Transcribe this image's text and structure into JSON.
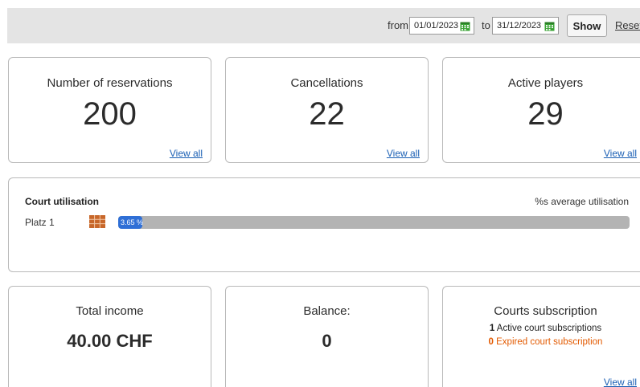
{
  "filter": {
    "from_label": "from",
    "from_value": "01/01/2023",
    "to_label": "to",
    "to_value": "31/12/2023",
    "show_label": "Show",
    "reset_label": "Reset"
  },
  "stats": {
    "reservations": {
      "title": "Number of reservations",
      "value": "200",
      "link": "View all"
    },
    "cancellations": {
      "title": "Cancellations",
      "value": "22",
      "link": "View all"
    },
    "players": {
      "title": "Active players",
      "value": "29",
      "link": "View all"
    }
  },
  "utilisation": {
    "title": "Court utilisation",
    "average_label": "%s average utilisation",
    "courts": [
      {
        "name": "Platz 1",
        "percent_label": "3.65 %",
        "percent": 3.65
      }
    ]
  },
  "finance": {
    "income": {
      "title": "Total income",
      "value": "40.00 CHF"
    },
    "balance": {
      "title": "Balance:",
      "value": "0"
    },
    "subscriptions": {
      "title": "Courts subscription",
      "active_count": "1",
      "active_text": "Active court subscriptions",
      "expired_count": "0",
      "expired_text": "Expired court subscription",
      "link": "View all"
    }
  },
  "colors": {
    "link": "#1a5fb4",
    "bar_fill": "#2f6fd6",
    "bar_track": "#b3b3b3",
    "expired": "#e35a00",
    "calendar_icon": "#3aa335",
    "court_icon": "#c8672a"
  },
  "icons": {
    "date_picker": "calendar-icon",
    "court": "court-icon"
  }
}
